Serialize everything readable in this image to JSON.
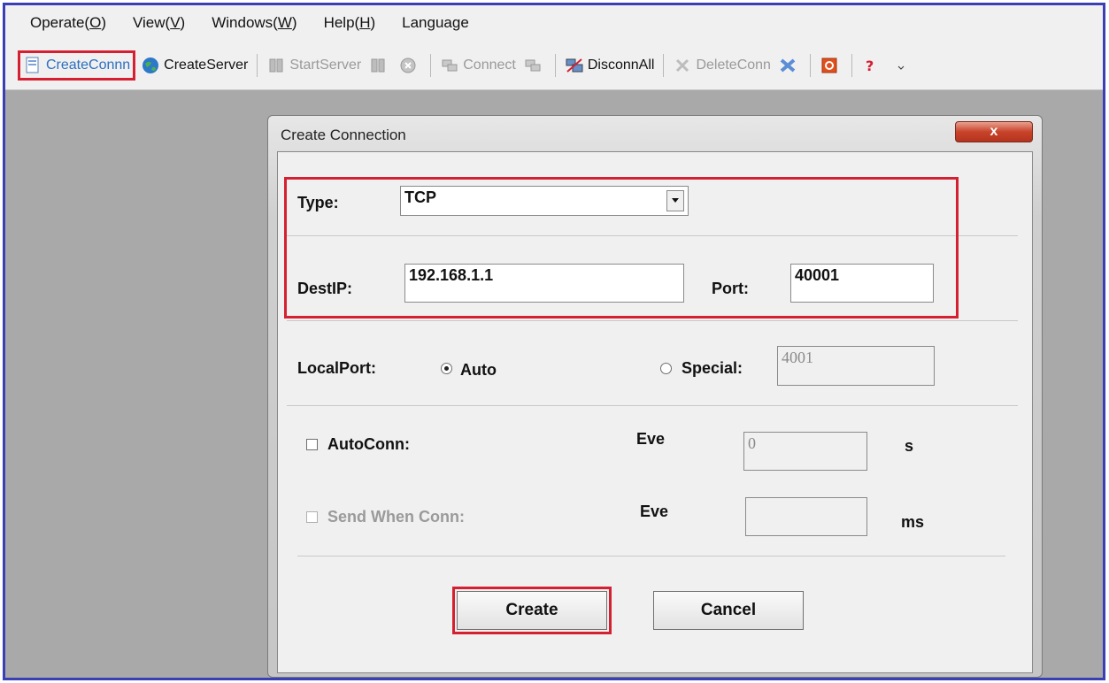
{
  "menu": [
    {
      "label": "Operate(",
      "key": "O"
    },
    {
      "label": "View(",
      "key": "V"
    },
    {
      "label": "Windows(",
      "key": "W"
    },
    {
      "label": "Help(",
      "key": "H"
    },
    {
      "label": "Language",
      "key": ""
    }
  ],
  "toolbar": {
    "create_conn": "CreateConnn",
    "create_server": "CreateServer",
    "start_server": "StartServer",
    "connect": "Connect",
    "disconn_all": "DisconnAll",
    "delete_conn": "DeleteConn"
  },
  "dialog": {
    "title": "Create Connection",
    "close_symbol": "x",
    "type_label": "Type:",
    "type_value": "TCP",
    "destip_label": "DestIP:",
    "destip_value": "192.168.1.1",
    "port_label": "Port:",
    "port_value": "40001",
    "localport_label": "LocalPort:",
    "auto_label": "Auto",
    "special_label": "Special:",
    "special_value": "4001",
    "autoconn_label": "AutoConn:",
    "eve_label_1": "Eve",
    "autoconn_value": "0",
    "unit_s": "s",
    "send_when_conn_label": "Send When Conn:",
    "eve_label_2": "Eve",
    "send_when_conn_value": "",
    "unit_ms": "ms",
    "create_button": "Create",
    "cancel_button": "Cancel"
  },
  "colors": {
    "highlight": "#d42030",
    "frame": "#3a3fb3",
    "close": "#c8432a"
  }
}
